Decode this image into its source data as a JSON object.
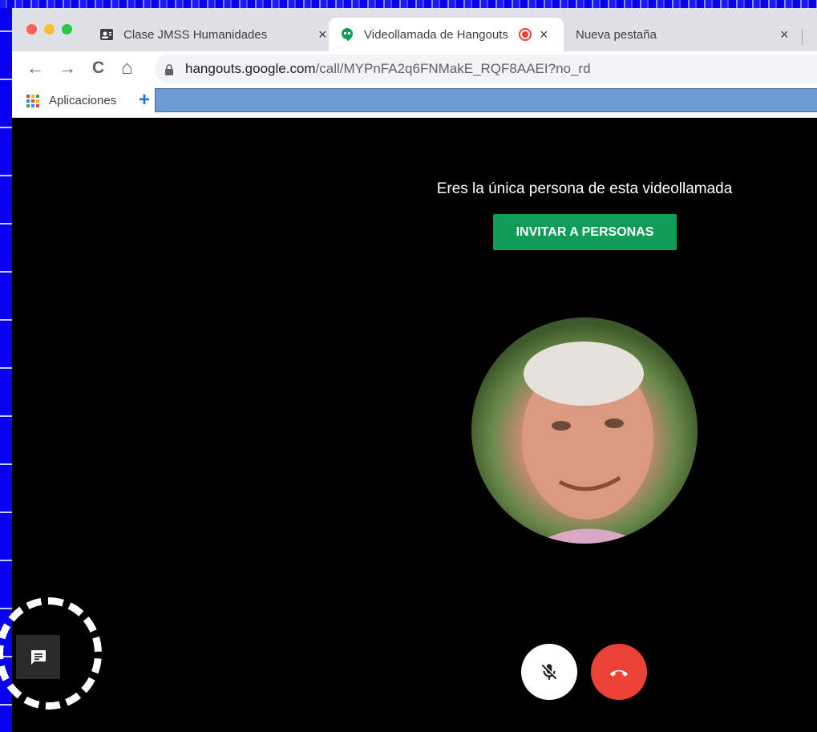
{
  "tabs": [
    {
      "label": "Clase JMSS Humanidades",
      "favicon": "contact-card-icon",
      "close": "×"
    },
    {
      "label": "Videollamada de Hangouts",
      "favicon": "hangouts-icon",
      "close": "×",
      "recording_indicator": "record-icon"
    },
    {
      "label": "Nueva pestaña",
      "favicon": "",
      "close": "×"
    }
  ],
  "toolbar": {
    "back": "←",
    "forward": "→",
    "reload": "C",
    "home": "⌂",
    "url_host": "hangouts.google.com",
    "url_path": "/call/MYPnFA2q6FNMakE_RQF8AAEI?no_rd"
  },
  "bookmarks": {
    "apps_label": "Aplicaciones",
    "add": "+"
  },
  "call": {
    "alone_message": "Eres la única persona de esta videollamada",
    "invite_label": "INVITAR A PERSONAS"
  },
  "colors": {
    "accent_green": "#0f9d58",
    "hangup_red": "#ea4335",
    "frame_blue": "#0a00f0"
  }
}
